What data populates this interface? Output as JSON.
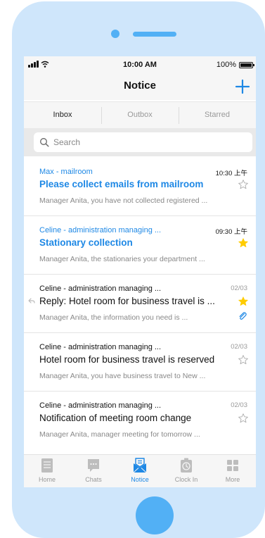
{
  "status_bar": {
    "time": "10:00 AM",
    "battery": "100%"
  },
  "header": {
    "title": "Notice",
    "add_label": "+"
  },
  "tabs": [
    {
      "label": "Inbox",
      "active": true
    },
    {
      "label": "Outbox",
      "active": false
    },
    {
      "label": "Starred",
      "active": false
    }
  ],
  "search": {
    "placeholder": "Search"
  },
  "mails": [
    {
      "sender": "Max - mailroom",
      "date": "10:30 上午",
      "subject": "Please collect emails from mailroom",
      "preview": "Manager Anita, you have not collected registered ...",
      "unread": true,
      "starred": false,
      "attachment": false,
      "replied": false
    },
    {
      "sender": "Celine - administration managing ...",
      "date": "09:30 上午",
      "subject": "Stationary collection",
      "preview": "Manager Anita, the stationaries your department ...",
      "unread": true,
      "starred": true,
      "attachment": false,
      "replied": false
    },
    {
      "sender": "Celine - administration managing ...",
      "date": "02/03",
      "subject": "Reply: Hotel room for business travel is ...",
      "preview": "Manager Anita, the information you need is ...",
      "unread": false,
      "starred": true,
      "attachment": true,
      "replied": true
    },
    {
      "sender": "Celine - administration managing ...",
      "date": "02/03",
      "subject": "Hotel room for business travel is reserved",
      "preview": "Manager Anita, you have business travel to New ...",
      "unread": false,
      "starred": false,
      "attachment": false,
      "replied": false
    },
    {
      "sender": "Celine - administration managing ...",
      "date": "02/03",
      "subject": "Notification of meeting room change",
      "preview": "Manager Anita, manager meeting for tomorrow ...",
      "unread": false,
      "starred": false,
      "attachment": false,
      "replied": false
    }
  ],
  "tab_bar": [
    {
      "label": "Home",
      "icon": "book-icon",
      "active": false
    },
    {
      "label": "Chats",
      "icon": "chat-bubble-icon",
      "active": false
    },
    {
      "label": "Notice",
      "icon": "mail-icon",
      "active": true
    },
    {
      "label": "Clock In",
      "icon": "clock-in-icon",
      "active": false
    },
    {
      "label": "More",
      "icon": "grid-icon",
      "active": false
    }
  ],
  "colors": {
    "accent": "#1e88e5",
    "star": "#ffcc00",
    "device": "#cfe6fb",
    "device_accent": "#52b0f5"
  }
}
